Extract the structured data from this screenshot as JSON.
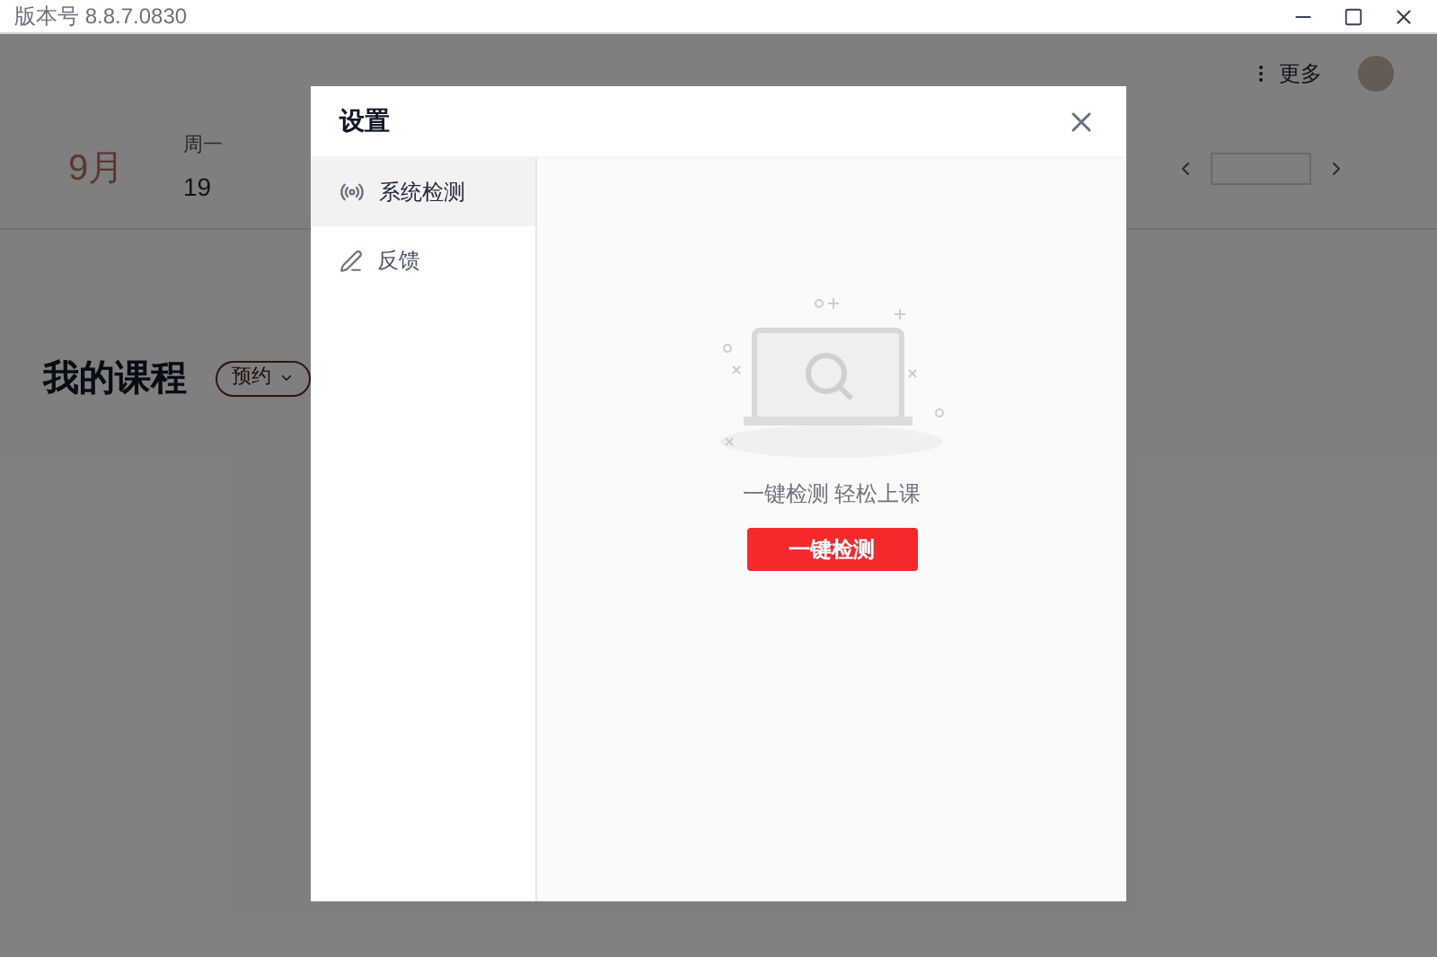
{
  "window": {
    "title": "版本号 8.8.7.0830"
  },
  "header": {
    "more": "更多"
  },
  "calendar": {
    "month": "9月",
    "days": [
      {
        "weekday": "周一",
        "date": "19"
      }
    ]
  },
  "courses": {
    "title": "我的课程",
    "filter": "预约"
  },
  "dialog": {
    "title": "设置",
    "menu": [
      {
        "kind": "detect",
        "label": "系统检测",
        "selected": true
      },
      {
        "kind": "feedback",
        "label": "反馈",
        "selected": false
      }
    ],
    "message": "一键检测 轻松上课",
    "button": "一键检测"
  }
}
